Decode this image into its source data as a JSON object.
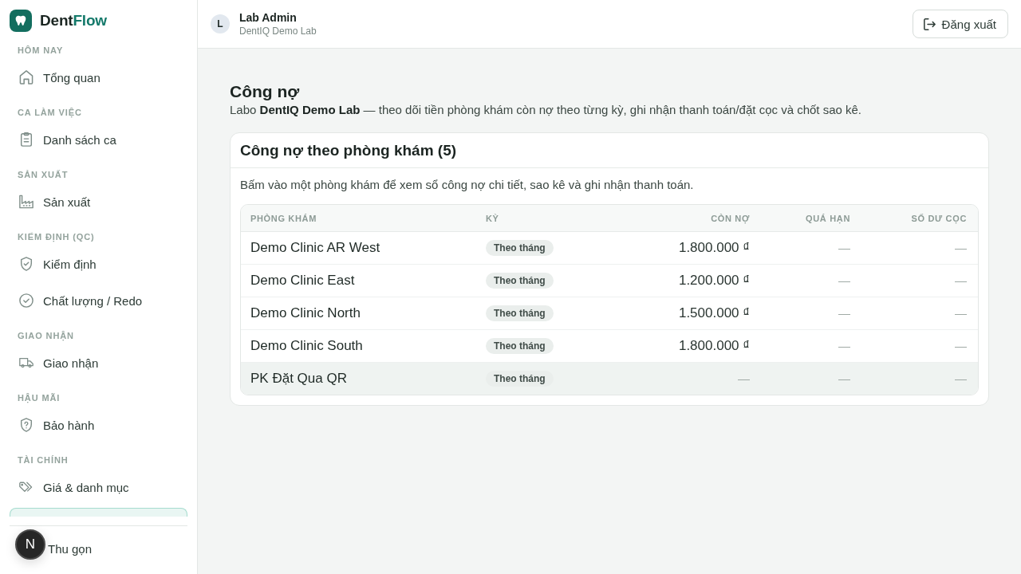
{
  "sidebar": {
    "brand": {
      "name": "Dent",
      "accent": "Flow"
    },
    "sections": [
      {
        "label": "HÔM NAY",
        "items": [
          {
            "label": "Tổng quan",
            "selected": false
          }
        ]
      },
      {
        "label": "CA LÀM VIỆC",
        "items": [
          {
            "label": "Danh sách ca",
            "selected": false
          }
        ]
      },
      {
        "label": "SẢN XUẤT",
        "items": [
          {
            "label": "Sản xuất",
            "selected": false
          }
        ]
      },
      {
        "label": "KIỂM ĐỊNH (QC)",
        "items": [
          {
            "label": "Kiểm định",
            "selected": false
          },
          {
            "label": "Chất lượng / Redo",
            "selected": false
          }
        ]
      },
      {
        "label": "GIAO NHẬN",
        "items": [
          {
            "label": "Giao nhận",
            "selected": false
          }
        ]
      },
      {
        "label": "HẬU MÃI",
        "items": [
          {
            "label": "Bảo hành",
            "selected": false
          }
        ]
      },
      {
        "label": "TÀI CHÍNH",
        "items": [
          {
            "label": "Giá & danh mục",
            "selected": false
          },
          {
            "selected": true
          }
        ]
      }
    ],
    "collapse_button": {
      "label": "Thu gọn"
    }
  },
  "dev_badge": {
    "label": "N"
  },
  "header": {
    "user": {
      "avatar": "L",
      "name": "Lab Admin",
      "organization": "DentIQ Demo Lab"
    },
    "logout_button": {
      "label": "Đăng xuất"
    }
  },
  "page": {
    "title": "Công nợ",
    "subtitle": "Labo **DentIQ Demo Lab** — theo dõi tiền phòng khám còn nợ theo từng kỳ, ghi nhận thanh toán/đặt cọc và chốt sao kê."
  },
  "card": {
    "title": "Công nợ theo phòng khám (5)",
    "description": "Bấm vào một phòng khám để xem sổ công nợ chi tiết, sao kê và ghi nhận thanh toán.",
    "table": {
      "columns": [
        "PHÒNG KHÁM",
        "KỲ",
        "CÒN NỢ",
        "QUÁ HẠN",
        "SỐ DƯ CỌC"
      ],
      "rows": [
        {
          "clinic": "Demo Clinic AR West",
          "period": "Theo tháng",
          "outstanding": "1.800.000 ₫",
          "overdue": "—",
          "deposit_balance": "—",
          "hovered": false
        },
        {
          "clinic": "Demo Clinic East",
          "period": "Theo tháng",
          "outstanding": "1.200.000 ₫",
          "overdue": "—",
          "deposit_balance": "—",
          "hovered": false
        },
        {
          "clinic": "Demo Clinic North",
          "period": "Theo tháng",
          "outstanding": "1.500.000 ₫",
          "overdue": "—",
          "deposit_balance": "—",
          "hovered": false
        },
        {
          "clinic": "Demo Clinic South",
          "period": "Theo tháng",
          "outstanding": "1.800.000 ₫",
          "overdue": "—",
          "deposit_balance": "—",
          "hovered": false
        },
        {
          "clinic": "PK Đặt Qua QR",
          "period": "Theo tháng",
          "outstanding": "—",
          "overdue": "—",
          "deposit_balance": "—",
          "hovered": true
        }
      ]
    }
  }
}
